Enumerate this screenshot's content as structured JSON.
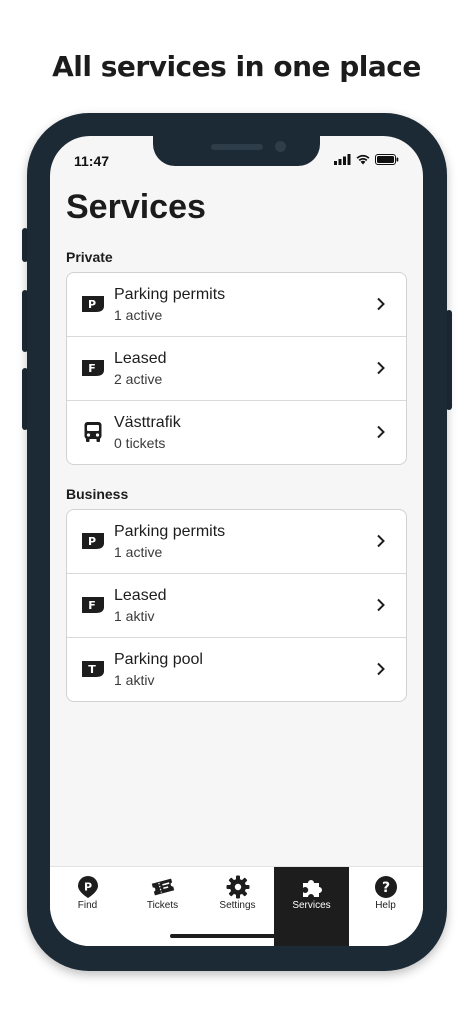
{
  "headline": "All services in one place",
  "status_bar": {
    "time": "11:47"
  },
  "page_title": "Services",
  "sections": [
    {
      "label": "Private",
      "items": [
        {
          "icon": "parking-permit-icon",
          "badge": "P",
          "title": "Parking permits",
          "subtitle": "1 active"
        },
        {
          "icon": "leased-icon",
          "badge": "F",
          "title": "Leased",
          "subtitle": "2 active"
        },
        {
          "icon": "bus-icon",
          "badge": "",
          "title": "Västtrafik",
          "subtitle": "0 tickets"
        }
      ]
    },
    {
      "label": "Business",
      "items": [
        {
          "icon": "parking-permit-icon",
          "badge": "P",
          "title": "Parking permits",
          "subtitle": "1 active"
        },
        {
          "icon": "leased-icon",
          "badge": "F",
          "title": "Leased",
          "subtitle": "1 aktiv"
        },
        {
          "icon": "parking-pool-icon",
          "badge": "T",
          "title": "Parking pool",
          "subtitle": "1 aktiv"
        }
      ]
    }
  ],
  "tabbar": {
    "items": [
      {
        "label": "Find",
        "icon": "parking-pin-icon"
      },
      {
        "label": "Tickets",
        "icon": "tickets-icon"
      },
      {
        "label": "Settings",
        "icon": "gear-icon"
      },
      {
        "label": "Services",
        "icon": "puzzle-icon",
        "active": true
      },
      {
        "label": "Help",
        "icon": "help-icon"
      }
    ]
  },
  "colors": {
    "frame": "#1c2a36",
    "active_tab": "#1d1d1d",
    "screen_bg": "#f6f6f6"
  }
}
